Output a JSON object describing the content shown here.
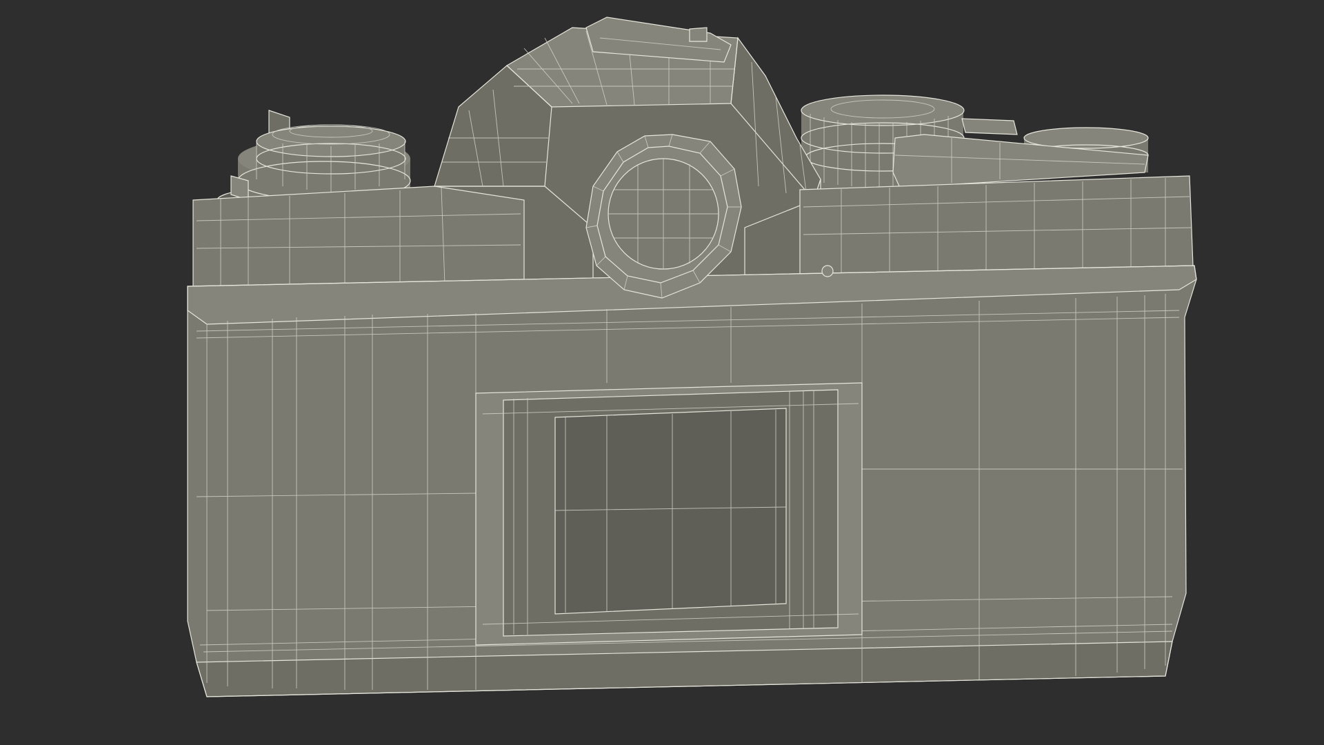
{
  "scene": {
    "subject": "camera-3d-model",
    "background_color": "#2e2e2e",
    "model_color": "#7a7a70",
    "wire_color": "#e6e6dc"
  }
}
